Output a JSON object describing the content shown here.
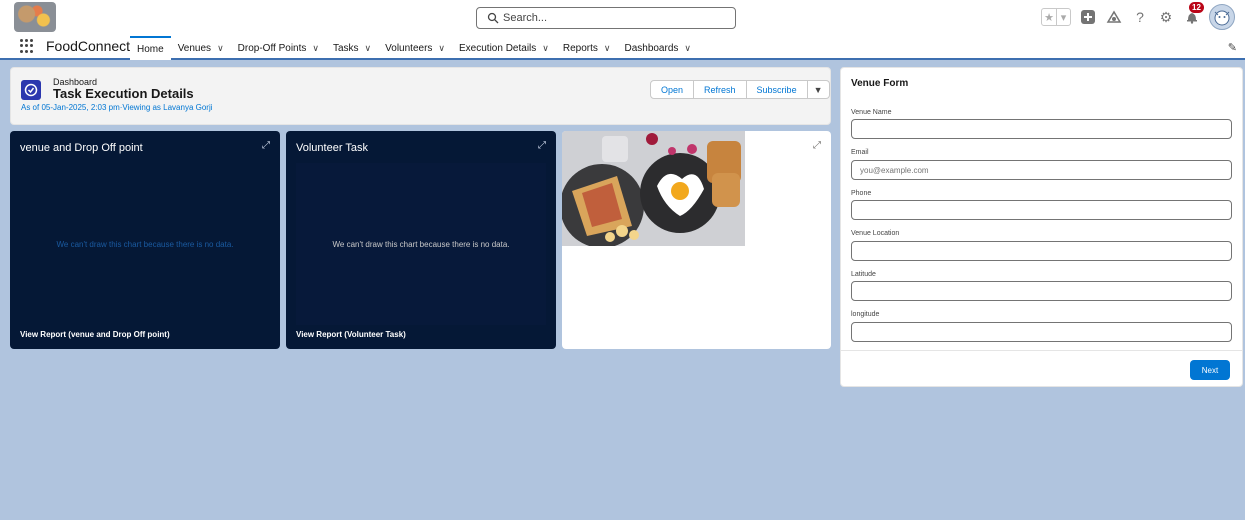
{
  "header": {
    "logo_icon": "food-collage-logo",
    "search_placeholder": "Search...",
    "notification_count": "12",
    "icons": [
      "favorites-star-icon",
      "favorites-list-icon",
      "global-add-icon",
      "trailhead-icon",
      "help-icon",
      "setup-gear-icon",
      "notification-bell-icon",
      "user-avatar-icon"
    ]
  },
  "nav": {
    "app_name": "FoodConnect",
    "items": [
      {
        "label": "Home",
        "active": true
      },
      {
        "label": "Venues",
        "chevron": true
      },
      {
        "label": "Drop-Off Points",
        "chevron": true
      },
      {
        "label": "Tasks",
        "chevron": true
      },
      {
        "label": "Volunteers",
        "chevron": true
      },
      {
        "label": "Execution Details",
        "chevron": true
      },
      {
        "label": "Reports",
        "chevron": true
      },
      {
        "label": "Dashboards",
        "chevron": true
      }
    ]
  },
  "dashboard": {
    "label": "Dashboard",
    "title": "Task Execution Details",
    "subtitle": "As of 05-Jan-2025, 2:03 pm·Viewing as Lavanya Gorji",
    "buttons": {
      "open": "Open",
      "refresh": "Refresh",
      "subscribe": "Subscribe"
    }
  },
  "widgets": [
    {
      "title": "venue and Drop Off point",
      "no_data": "We can't draw this chart because there is no data.",
      "report_link": "View Report (venue and Drop Off point)"
    },
    {
      "title": "Volunteer Task",
      "no_data": "We can't draw this chart because there is no data.",
      "report_link": "View Report (Volunteer Task)"
    }
  ],
  "image_widget": {
    "image_icon": "breakfast-photo"
  },
  "form": {
    "title": "Venue Form",
    "fields": [
      {
        "label": "Venue Name",
        "value": "",
        "placeholder": ""
      },
      {
        "label": "Email",
        "value": "",
        "placeholder": "you@example.com"
      },
      {
        "label": "Phone",
        "value": "",
        "placeholder": ""
      },
      {
        "label": "Venue Location",
        "value": "",
        "placeholder": ""
      },
      {
        "label": "Latitude",
        "value": "",
        "placeholder": ""
      },
      {
        "label": "longitude",
        "value": "",
        "placeholder": ""
      }
    ],
    "next_label": "Next"
  },
  "colors": {
    "brand": "#0176d3",
    "dashboard_dark": "#051836",
    "page_bg": "#b0c4de"
  }
}
